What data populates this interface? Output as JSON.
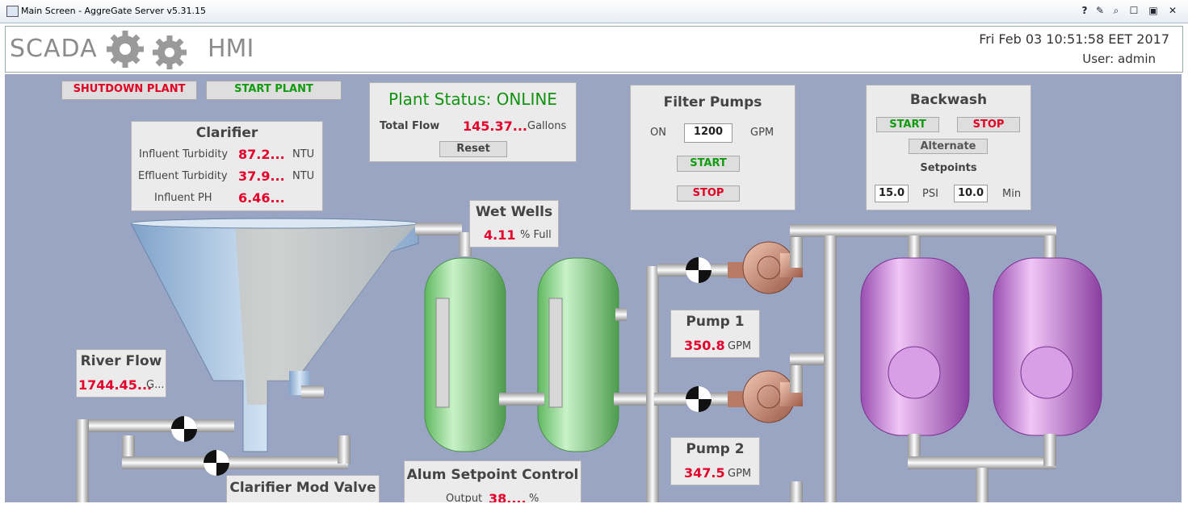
{
  "window": {
    "title": "Main Screen - AggreGate Server v5.31.15"
  },
  "header": {
    "logo_left": "SCADA",
    "logo_right": "HMI",
    "datetime": "Fri Feb 03 10:51:58 EET 2017",
    "user": "User:  admin"
  },
  "controls": {
    "shutdown": "SHUTDOWN PLANT",
    "start": "START PLANT"
  },
  "plant_status": {
    "status": "Plant Status: ONLINE",
    "flow_label": "Total Flow",
    "flow_value": "145.37...",
    "flow_unit": "Gallons",
    "reset": "Reset"
  },
  "clarifier": {
    "title": "Clarifier",
    "rows": [
      {
        "label": "Influent Turbidity",
        "value": "87.2...",
        "unit": "NTU"
      },
      {
        "label": "Effluent Turbidity",
        "value": "37.9...",
        "unit": "NTU"
      },
      {
        "label": "Influent PH",
        "value": "6.46...",
        "unit": ""
      }
    ]
  },
  "filter_pumps": {
    "title": "Filter Pumps",
    "on": "ON",
    "value": "1200",
    "unit": "GPM",
    "start": "START",
    "stop": "STOP"
  },
  "backwash": {
    "title": "Backwash",
    "start": "START",
    "stop": "STOP",
    "alternate": "Alternate",
    "setpoints": "Setpoints",
    "psi_value": "15.0",
    "psi": "PSI",
    "min_value": "10.0",
    "min": "Min"
  },
  "wet_wells": {
    "title": "Wet Wells",
    "value": "4.11",
    "unit": "% Full"
  },
  "river_flow": {
    "title": "River Flow",
    "value": "1744.45...",
    "unit": "G..."
  },
  "pump1": {
    "title": "Pump 1",
    "value": "350.8",
    "unit": "GPM"
  },
  "pump2": {
    "title": "Pump 2",
    "value": "347.5",
    "unit": "GPM"
  },
  "alum": {
    "title": "Alum Setpoint Control",
    "label": "Output",
    "value": "38....",
    "unit": "%"
  },
  "clarifier_valve": {
    "title": "Clarifier Mod Valve"
  },
  "colors": {
    "canvas": "#9aa5c4",
    "alarm_red": "#e4002b",
    "ok_green": "#119b10",
    "tank_green": "#8fd98f",
    "tank_purple": "#c77fd6"
  }
}
